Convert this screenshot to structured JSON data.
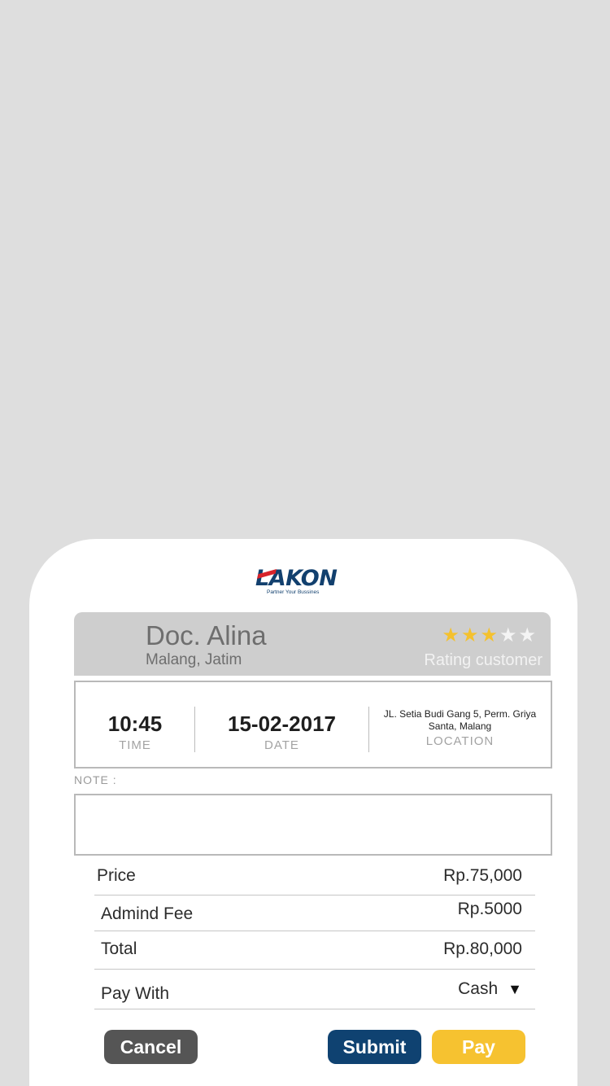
{
  "brand": {
    "logo_text": "LAKON",
    "tagline": "Partner Your Bussines"
  },
  "customer": {
    "name": "Doc. Alina",
    "location": "Malang, Jatim",
    "rating_value": 3,
    "rating_max": 5,
    "rating_label": "Rating customer"
  },
  "appointment": {
    "time": "10:45",
    "time_label": "TIME",
    "date": "15-02-2017",
    "date_label": "DATE",
    "address": "JL. Setia Budi Gang 5, Perm. Griya Santa, Malang",
    "location_label": "LOCATION"
  },
  "note": {
    "label": "NOTE :",
    "value": ""
  },
  "summary": {
    "price_label": "Price",
    "price_value": "Rp.75,000",
    "admin_label": "Admind Fee",
    "admin_value": "Rp.5000",
    "total_label": "Total",
    "total_value": "Rp.80,000",
    "pay_with_label": "Pay With",
    "pay_with_value": "Cash"
  },
  "actions": {
    "cancel": "Cancel",
    "submit": "Submit",
    "pay": "Pay"
  },
  "colors": {
    "brand_blue": "#0f4271",
    "accent_yellow": "#f6c230",
    "cancel_gray": "#555555",
    "logo_red": "#d8232a"
  }
}
